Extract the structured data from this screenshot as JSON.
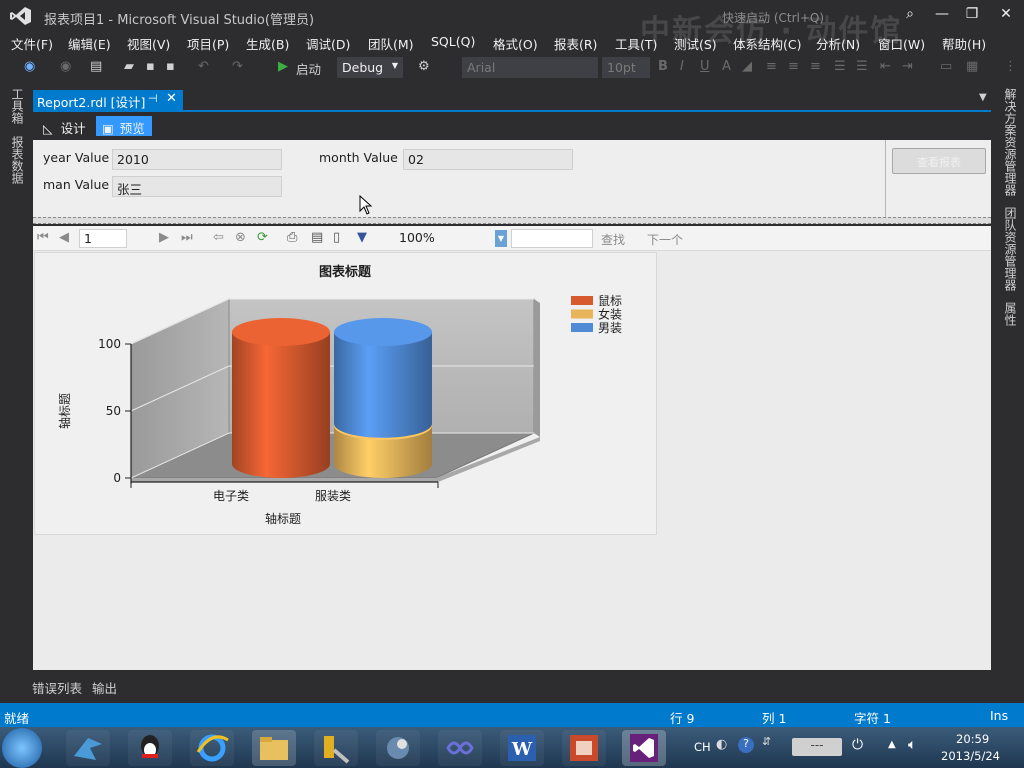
{
  "window": {
    "title": "报表项目1 - Microsoft Visual Studio(管理员)",
    "quick_launch": "快速启动 (Ctrl+Q)",
    "watermark": "中新会仿 · 动件馆",
    "controls": [
      "minimize",
      "maximize",
      "close"
    ]
  },
  "menu": [
    "文件(F)",
    "编辑(E)",
    "视图(V)",
    "项目(P)",
    "生成(B)",
    "调试(D)",
    "团队(M)",
    "SQL(Q)",
    "格式(O)",
    "报表(R)",
    "工具(T)",
    "测试(S)",
    "体系结构(C)",
    "分析(N)",
    "窗口(W)",
    "帮助(H)"
  ],
  "toolbar": {
    "start_label": "启动",
    "config": "Debug",
    "font": "Arial",
    "font_size": "10pt"
  },
  "left_rail": [
    "工具箱",
    "报表数据"
  ],
  "right_rail": [
    "解决方案资源管理器",
    "团队资源管理器",
    "属性"
  ],
  "document": {
    "tab_title": "Report2.rdl [设计]",
    "pin_icon": "pin-icon",
    "close_icon": "close-icon"
  },
  "modes": {
    "design": "设计",
    "preview": "预览",
    "active": "preview"
  },
  "parameters": {
    "year_label": "year Value",
    "year_value": "2010",
    "month_label": "month Value",
    "month_value": "02",
    "man_label": "man Value",
    "man_value": "张三",
    "view_report": "查看报表"
  },
  "viewer": {
    "page": "1",
    "zoom": "100%",
    "find": "查找",
    "next": "下一个"
  },
  "chart_data": {
    "type": "bar",
    "stacked": true,
    "style": "3d-cylinder",
    "title": "图表标题",
    "xlabel": "轴标题",
    "ylabel": "轴标题",
    "categories": [
      "电子类",
      "服装类"
    ],
    "ylim": [
      0,
      100
    ],
    "yticks": [
      0,
      50,
      100
    ],
    "series": [
      {
        "name": "鼠标",
        "values": [
          100,
          0
        ],
        "color": "#d65a2e"
      },
      {
        "name": "女装",
        "values": [
          0,
          30
        ],
        "color": "#e8b45a"
      },
      {
        "name": "男装",
        "values": [
          0,
          70
        ],
        "color": "#4f8ad6"
      }
    ],
    "legend": "top-right"
  },
  "bottom_tabs": [
    "错误列表",
    "输出"
  ],
  "status": {
    "text": "就绪",
    "line": "行 9",
    "col": "列 1",
    "char": "字符 1",
    "mode": "Ins"
  },
  "taskbar": {
    "lang": "CH",
    "time": "20:59",
    "date": "2013/5/24"
  }
}
